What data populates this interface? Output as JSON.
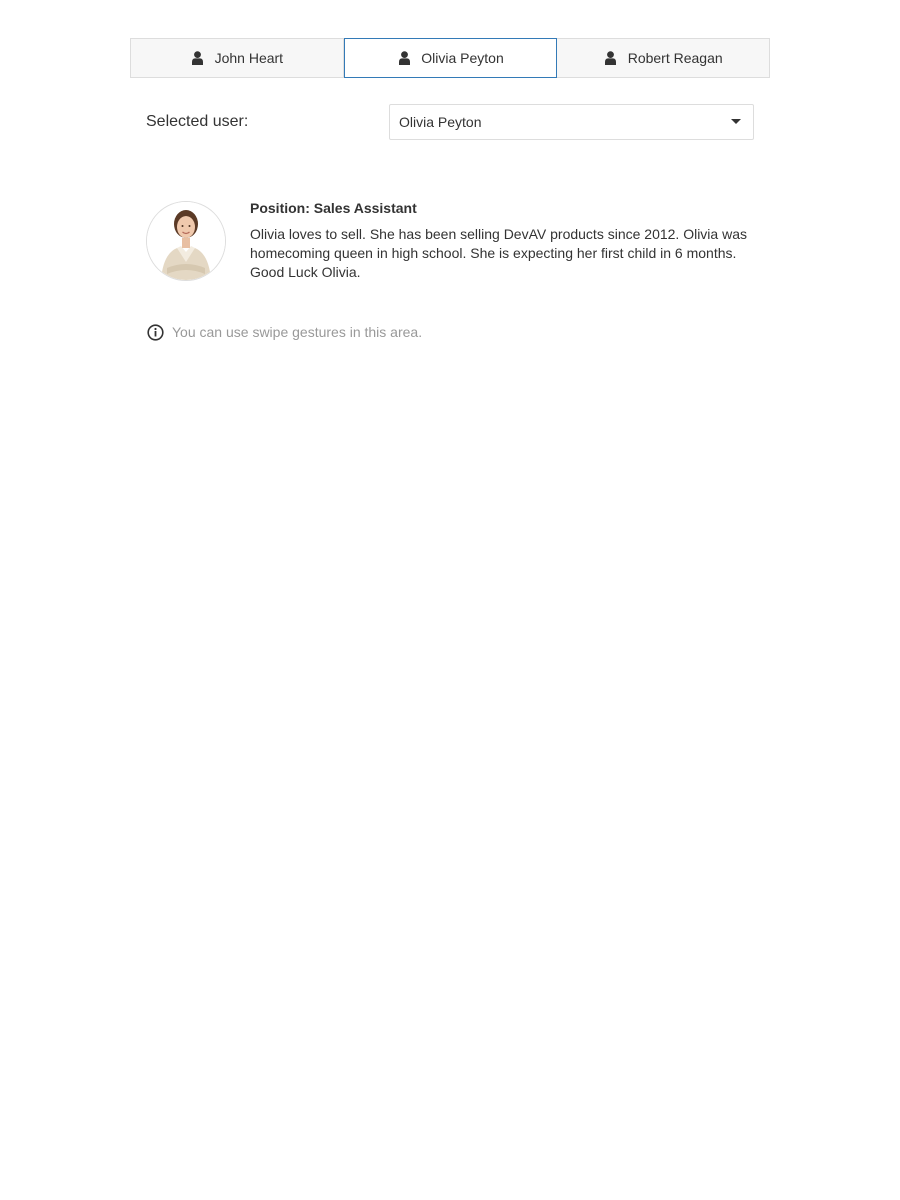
{
  "tabs": [
    {
      "label": "John Heart",
      "icon": "user-icon",
      "selected": false
    },
    {
      "label": "Olivia Peyton",
      "icon": "user-icon",
      "selected": true
    },
    {
      "label": "Robert Reagan",
      "icon": "user-icon",
      "selected": false
    }
  ],
  "selector": {
    "label": "Selected user:",
    "value": "Olivia Peyton"
  },
  "profile": {
    "position": "Position: Sales Assistant",
    "bio": "Olivia loves to sell. She has been selling DevAV products since 2012. Olivia was homecoming queen in high school. She is expecting her first child in 6 months. Good Luck Olivia.",
    "avatar": "employee-photo"
  },
  "hint": {
    "icon": "info-icon",
    "text": "You can use swipe gestures in this area."
  },
  "colors": {
    "active_border": "#337ab7",
    "tab_background": "#f7f7f7",
    "hint_text": "#999999"
  }
}
